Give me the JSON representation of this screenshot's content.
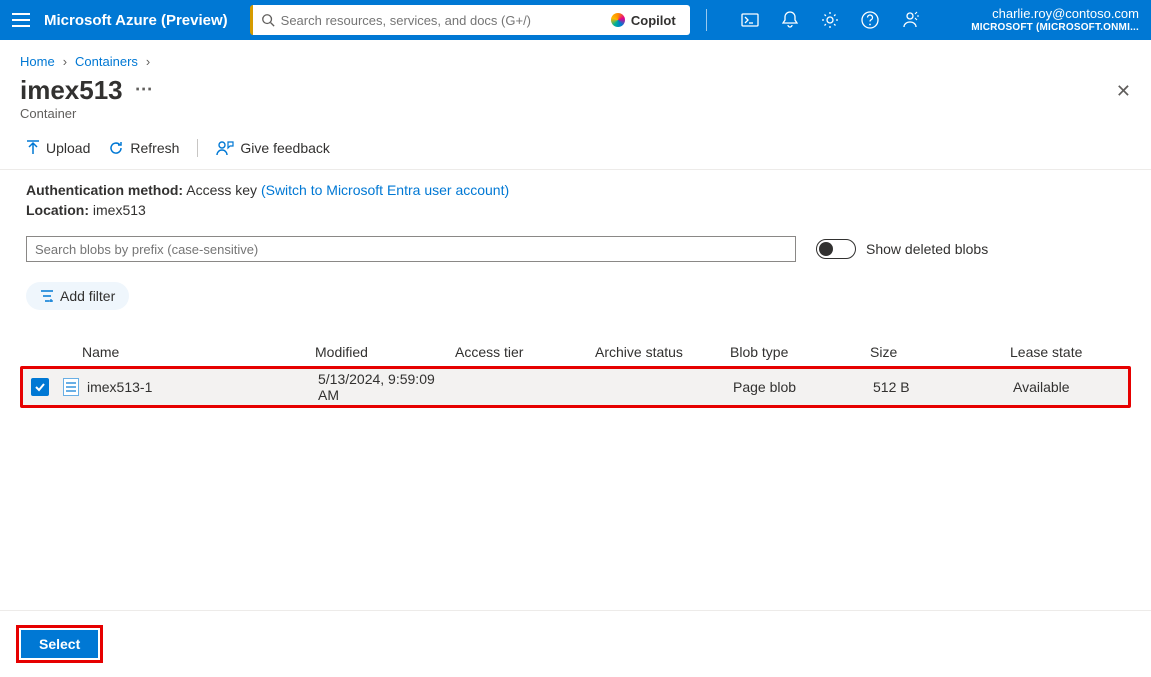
{
  "header": {
    "brand": "Microsoft Azure (Preview)",
    "search_placeholder": "Search resources, services, and docs (G+/)",
    "copilot_label": "Copilot",
    "account_email": "charlie.roy@contoso.com",
    "account_tenant": "MICROSOFT (MICROSOFT.ONMI..."
  },
  "breadcrumb": {
    "items": [
      "Home",
      "Containers"
    ]
  },
  "page": {
    "title": "imex513",
    "subtitle": "Container"
  },
  "toolbar": {
    "upload": "Upload",
    "refresh": "Refresh",
    "feedback": "Give feedback"
  },
  "info": {
    "auth_label": "Authentication method:",
    "auth_value": "Access key",
    "auth_link": "(Switch to Microsoft Entra user account)",
    "location_label": "Location:",
    "location_value": "imex513"
  },
  "filter": {
    "search_placeholder": "Search blobs by prefix (case-sensitive)",
    "toggle_label": "Show deleted blobs",
    "add_filter": "Add filter"
  },
  "grid": {
    "columns": {
      "name": "Name",
      "modified": "Modified",
      "access_tier": "Access tier",
      "archive_status": "Archive status",
      "blob_type": "Blob type",
      "size": "Size",
      "lease_state": "Lease state"
    },
    "rows": [
      {
        "name": "imex513-1",
        "modified": "5/13/2024, 9:59:09 AM",
        "access_tier": "",
        "archive_status": "",
        "blob_type": "Page blob",
        "size": "512 B",
        "lease_state": "Available",
        "selected": true
      }
    ]
  },
  "footer": {
    "select": "Select"
  }
}
